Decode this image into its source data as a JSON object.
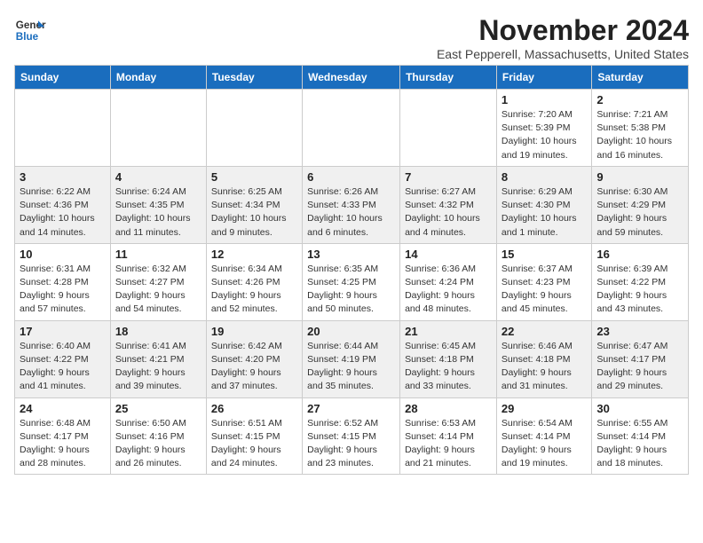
{
  "logo": {
    "line1": "General",
    "line2": "Blue"
  },
  "title": "November 2024",
  "location": "East Pepperell, Massachusetts, United States",
  "weekdays": [
    "Sunday",
    "Monday",
    "Tuesday",
    "Wednesday",
    "Thursday",
    "Friday",
    "Saturday"
  ],
  "weeks": [
    [
      {
        "day": "",
        "info": ""
      },
      {
        "day": "",
        "info": ""
      },
      {
        "day": "",
        "info": ""
      },
      {
        "day": "",
        "info": ""
      },
      {
        "day": "",
        "info": ""
      },
      {
        "day": "1",
        "info": "Sunrise: 7:20 AM\nSunset: 5:39 PM\nDaylight: 10 hours and 19 minutes."
      },
      {
        "day": "2",
        "info": "Sunrise: 7:21 AM\nSunset: 5:38 PM\nDaylight: 10 hours and 16 minutes."
      }
    ],
    [
      {
        "day": "3",
        "info": "Sunrise: 6:22 AM\nSunset: 4:36 PM\nDaylight: 10 hours and 14 minutes."
      },
      {
        "day": "4",
        "info": "Sunrise: 6:24 AM\nSunset: 4:35 PM\nDaylight: 10 hours and 11 minutes."
      },
      {
        "day": "5",
        "info": "Sunrise: 6:25 AM\nSunset: 4:34 PM\nDaylight: 10 hours and 9 minutes."
      },
      {
        "day": "6",
        "info": "Sunrise: 6:26 AM\nSunset: 4:33 PM\nDaylight: 10 hours and 6 minutes."
      },
      {
        "day": "7",
        "info": "Sunrise: 6:27 AM\nSunset: 4:32 PM\nDaylight: 10 hours and 4 minutes."
      },
      {
        "day": "8",
        "info": "Sunrise: 6:29 AM\nSunset: 4:30 PM\nDaylight: 10 hours and 1 minute."
      },
      {
        "day": "9",
        "info": "Sunrise: 6:30 AM\nSunset: 4:29 PM\nDaylight: 9 hours and 59 minutes."
      }
    ],
    [
      {
        "day": "10",
        "info": "Sunrise: 6:31 AM\nSunset: 4:28 PM\nDaylight: 9 hours and 57 minutes."
      },
      {
        "day": "11",
        "info": "Sunrise: 6:32 AM\nSunset: 4:27 PM\nDaylight: 9 hours and 54 minutes."
      },
      {
        "day": "12",
        "info": "Sunrise: 6:34 AM\nSunset: 4:26 PM\nDaylight: 9 hours and 52 minutes."
      },
      {
        "day": "13",
        "info": "Sunrise: 6:35 AM\nSunset: 4:25 PM\nDaylight: 9 hours and 50 minutes."
      },
      {
        "day": "14",
        "info": "Sunrise: 6:36 AM\nSunset: 4:24 PM\nDaylight: 9 hours and 48 minutes."
      },
      {
        "day": "15",
        "info": "Sunrise: 6:37 AM\nSunset: 4:23 PM\nDaylight: 9 hours and 45 minutes."
      },
      {
        "day": "16",
        "info": "Sunrise: 6:39 AM\nSunset: 4:22 PM\nDaylight: 9 hours and 43 minutes."
      }
    ],
    [
      {
        "day": "17",
        "info": "Sunrise: 6:40 AM\nSunset: 4:22 PM\nDaylight: 9 hours and 41 minutes."
      },
      {
        "day": "18",
        "info": "Sunrise: 6:41 AM\nSunset: 4:21 PM\nDaylight: 9 hours and 39 minutes."
      },
      {
        "day": "19",
        "info": "Sunrise: 6:42 AM\nSunset: 4:20 PM\nDaylight: 9 hours and 37 minutes."
      },
      {
        "day": "20",
        "info": "Sunrise: 6:44 AM\nSunset: 4:19 PM\nDaylight: 9 hours and 35 minutes."
      },
      {
        "day": "21",
        "info": "Sunrise: 6:45 AM\nSunset: 4:18 PM\nDaylight: 9 hours and 33 minutes."
      },
      {
        "day": "22",
        "info": "Sunrise: 6:46 AM\nSunset: 4:18 PM\nDaylight: 9 hours and 31 minutes."
      },
      {
        "day": "23",
        "info": "Sunrise: 6:47 AM\nSunset: 4:17 PM\nDaylight: 9 hours and 29 minutes."
      }
    ],
    [
      {
        "day": "24",
        "info": "Sunrise: 6:48 AM\nSunset: 4:17 PM\nDaylight: 9 hours and 28 minutes."
      },
      {
        "day": "25",
        "info": "Sunrise: 6:50 AM\nSunset: 4:16 PM\nDaylight: 9 hours and 26 minutes."
      },
      {
        "day": "26",
        "info": "Sunrise: 6:51 AM\nSunset: 4:15 PM\nDaylight: 9 hours and 24 minutes."
      },
      {
        "day": "27",
        "info": "Sunrise: 6:52 AM\nSunset: 4:15 PM\nDaylight: 9 hours and 23 minutes."
      },
      {
        "day": "28",
        "info": "Sunrise: 6:53 AM\nSunset: 4:14 PM\nDaylight: 9 hours and 21 minutes."
      },
      {
        "day": "29",
        "info": "Sunrise: 6:54 AM\nSunset: 4:14 PM\nDaylight: 9 hours and 19 minutes."
      },
      {
        "day": "30",
        "info": "Sunrise: 6:55 AM\nSunset: 4:14 PM\nDaylight: 9 hours and 18 minutes."
      }
    ]
  ]
}
